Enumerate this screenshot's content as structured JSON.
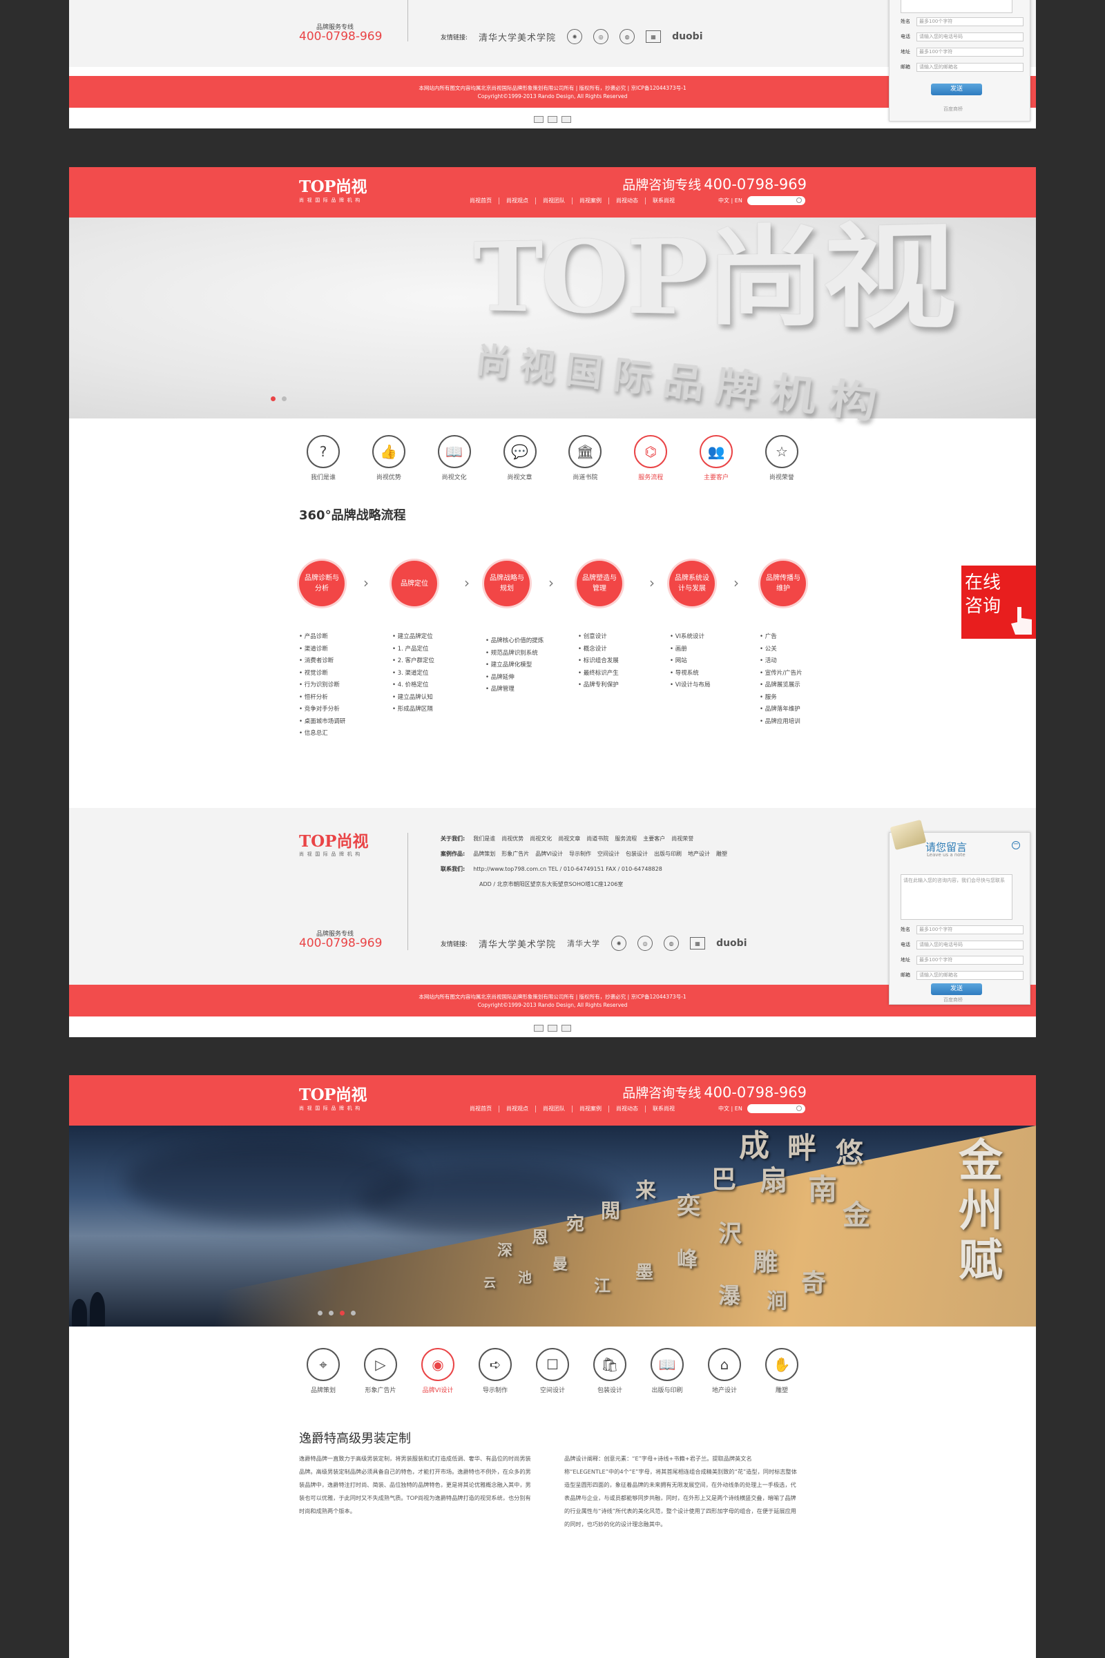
{
  "header": {
    "logo": "TOP尚视",
    "logo_sub": "尚视国际品牌机构",
    "hotline_label": "品牌咨询专线",
    "hotline_number": "400-0798-969",
    "nav": [
      "尚视首页",
      "尚视观点",
      "尚视团队",
      "尚视案例",
      "尚视动态",
      "联系尚视"
    ],
    "lang": "中文 | EN"
  },
  "footer": {
    "logo": "TOP尚视",
    "logo_sub": "尚视国际品牌机构",
    "about_label": "关于我们:",
    "about_links": [
      "我们是谁",
      "尚视优势",
      "尚视文化",
      "尚视文章",
      "尚道书院",
      "服务流程",
      "主要客户",
      "尚视荣誉"
    ],
    "cases_label": "案例作品:",
    "cases_links": [
      "品牌策划",
      "形象广告片",
      "品牌VI设计",
      "导示制作",
      "空间设计",
      "包装设计",
      "出版与印刷",
      "地产设计",
      "雕塑"
    ],
    "contact_label": "联系我们:",
    "contact_line1": "http://www.top798.com.cn    TEL / 010-64749151    FAX / 010-64748828",
    "contact_line2": "ADD / 北京市朝阳区望京东大街望京SOHO塔1C座1206室",
    "hotline_label": "品牌服务专线",
    "hotline_number": "400-0798-969",
    "friend_label": "友情链接:",
    "partners": [
      "清华大学美术学院",
      "清华大学",
      "logo-seal-1",
      "logo-seal-2",
      "logo-seal-3",
      "logo-seal-4",
      "duobi"
    ],
    "copyright_1": "本网站内所有图文内容均属北京尚视国际品牌形象策划有限公司所有 | 版权所有，抄袭必究 | 京ICP备12044373号-1",
    "copyright_2": "Copyright©1999-2013 Rando Design, All Rights Reserved"
  },
  "message": {
    "title": "请您留言",
    "subtitle": "Leave us a note",
    "textarea_placeholder": "请在此输入您的咨询内容，我们会尽快与您联系",
    "fields": [
      {
        "label": "姓名",
        "placeholder": "最多100个字符"
      },
      {
        "label": "电话",
        "placeholder": "请输入您的电话号码"
      },
      {
        "label": "地址",
        "placeholder": "最多100个字符"
      },
      {
        "label": "邮箱",
        "placeholder": "请输入您的邮箱名"
      }
    ],
    "send_label": "发送",
    "footer_text": "百度商桥"
  },
  "page2": {
    "icons": [
      {
        "label": "我们是谁",
        "glyph": "?",
        "icon": "question-icon",
        "active": false
      },
      {
        "label": "尚视优势",
        "glyph": "👍",
        "icon": "thumbs-up-icon",
        "active": false
      },
      {
        "label": "尚视文化",
        "glyph": "📖",
        "icon": "book-icon",
        "active": false
      },
      {
        "label": "尚视文章",
        "glyph": "💬",
        "icon": "chat-icon",
        "active": false
      },
      {
        "label": "尚道书院",
        "glyph": "🏛",
        "icon": "academy-icon",
        "active": false
      },
      {
        "label": "服务流程",
        "glyph": "⌬",
        "icon": "flow-icon",
        "active": true
      },
      {
        "label": "主要客户",
        "glyph": "👥",
        "icon": "clients-icon",
        "active": true
      },
      {
        "label": "尚视荣誉",
        "glyph": "☆",
        "icon": "star-icon",
        "active": false
      }
    ],
    "process_title": "360°品牌战略流程",
    "steps": [
      {
        "label": "品牌诊断与分析",
        "items": [
          "产品诊断",
          "渠道诊断",
          "消费者诊断",
          "视觉诊断",
          "行为识别诊断",
          "恒杆分析",
          "竞争对手分析",
          "桌面城市场调研",
          "信息总汇"
        ],
        "numbered": false
      },
      {
        "label": "品牌定位",
        "items": [
          "建立品牌定位",
          "1. 产品定位",
          "2. 客户群定位",
          "3. 渠道定位",
          "4. 价格定位",
          "建立品牌认知",
          "形成品牌区隔"
        ],
        "numbered": false
      },
      {
        "label": "品牌战略与规划",
        "items": [
          "品牌核心价值的提炼",
          "规范品牌识别系统",
          "建立品牌化模型",
          "品牌延伸",
          "品牌管理"
        ],
        "numbered": false
      },
      {
        "label": "品牌塑造与管理",
        "items": [
          "创意设计",
          "概念设计",
          "标识组合发展",
          "最终标识产生",
          "品牌专利保护"
        ],
        "numbered": false
      },
      {
        "label": "品牌系统设计与发展",
        "items": [
          "VI系统设计",
          "画册",
          "网站",
          "导视系统",
          "VI设计与布局"
        ],
        "numbered": false
      },
      {
        "label": "品牌传播与维护",
        "items": [
          "广告",
          "公关",
          "活动",
          "宣传片/广告片",
          "品牌展览展示",
          "服务",
          "品牌落年维护",
          "品牌应用培训"
        ],
        "numbered": false
      }
    ],
    "consult_label": "在线咨询"
  },
  "page3": {
    "hero_sign": "金州赋",
    "icons": [
      {
        "label": "品牌策划",
        "glyph": "⌖",
        "icon": "location-pin-icon",
        "active": false
      },
      {
        "label": "形象广告片",
        "glyph": "▷",
        "icon": "play-icon",
        "active": false
      },
      {
        "label": "品牌VI设计",
        "glyph": "◉",
        "icon": "eye-icon",
        "active": true
      },
      {
        "label": "导示制作",
        "glyph": "➪",
        "icon": "signpost-icon",
        "active": false
      },
      {
        "label": "空间设计",
        "glyph": "☐",
        "icon": "cube-icon",
        "active": false
      },
      {
        "label": "包装设计",
        "glyph": "🛍",
        "icon": "bag-icon",
        "active": false
      },
      {
        "label": "出版与印刷",
        "glyph": "📖",
        "icon": "book-icon",
        "active": false
      },
      {
        "label": "地产设计",
        "glyph": "⌂",
        "icon": "house-icon",
        "active": false
      },
      {
        "label": "雕塑",
        "glyph": "✋",
        "icon": "sculpture-icon",
        "active": false
      }
    ],
    "article_title": "逸爵特高级男装定制",
    "article_left": "逸爵特品牌一直致力于高级男装定制，将男装服装和式打造成低调、奢华、有品位的时尚男装品牌。高级男装定制品牌必须具备自己的特色，才能打开市场。逸爵特也不例外，在众多的男装品牌中，逸爵特注打时尚、简装、品位独特的品牌特色，更是将其论优雅概念融入其中，男装也可以优雅，于此同时又不失成熟气质。TOP尚视为逸爵特品牌打造的视觉系统，也分别有时尚和成熟两个版本。",
    "article_right": "品牌设计阐释：创意元素：“E”字母+诗线+书籍+君子兰。提取品牌英文名称“ELEGENTLE”中的4个“E”字母，将其首尾相连组合成精美别致的“花”造型，同时标志整体造型呈圆形四面的，象征着品牌的未来拥有无限发展空间，在外动线条的处理上一手极选，代表品牌与企业，与或员都能够同步共融，同时，在外形上又是两个诗线横竖交叠，暗喻了品牌的行业属性与“诗线”所代表的美化风范，整个设计使用了四形加字母的组合，在便于延展应用的同时，也巧妙的化的设计理念融其中。"
  }
}
